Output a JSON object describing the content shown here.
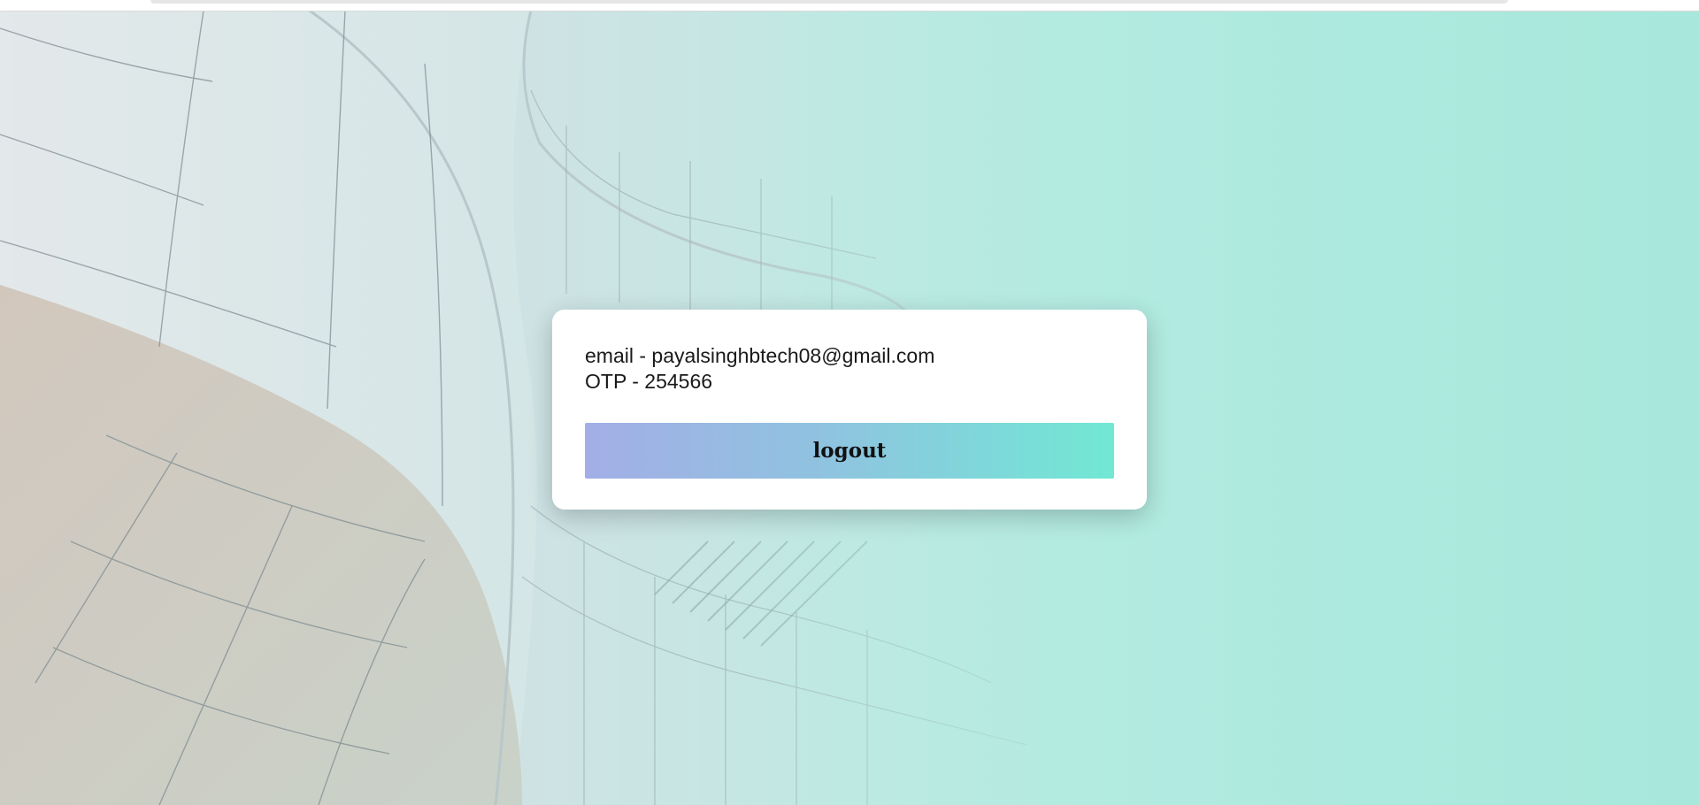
{
  "card": {
    "email_line": "email - payalsinghbtech08@gmail.com",
    "otp_line": "OTP - 254566",
    "logout_label": "logout"
  },
  "colors": {
    "button_gradient_start": "#a3aee6",
    "button_gradient_end": "#71e8d4",
    "background_mint": "#a8e8dc",
    "card_background": "#ffffff"
  }
}
